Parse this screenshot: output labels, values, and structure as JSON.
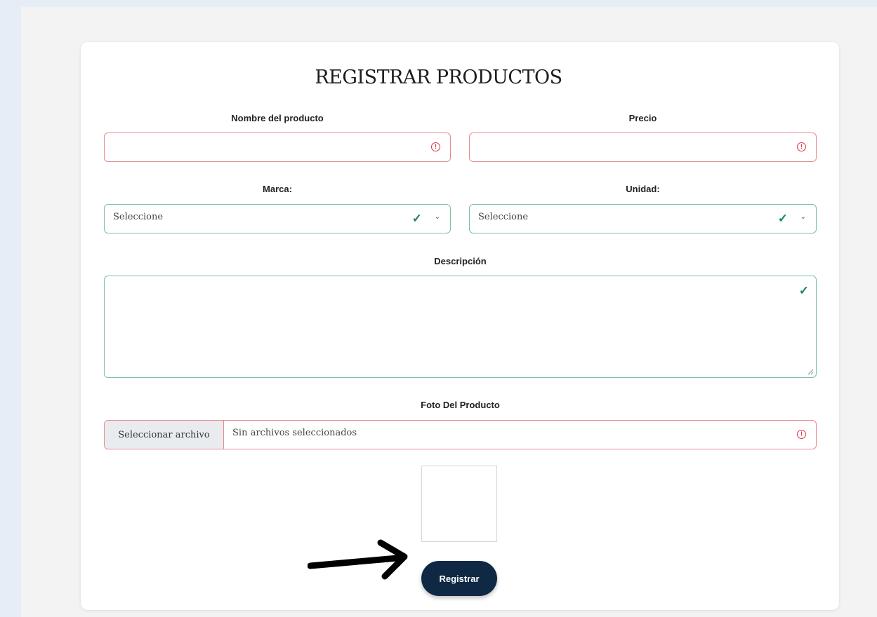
{
  "form": {
    "title": "REGISTRAR PRODUCTOS",
    "name_label": "Nombre del producto",
    "price_label": "Precio",
    "brand_label": "Marca:",
    "brand_value": "Seleccione",
    "unit_label": "Unidad:",
    "unit_value": "Seleccione",
    "description_label": "Descripción",
    "photo_label": "Foto Del Producto",
    "file_button": "Seleccionar archivo",
    "file_status": "Sin archivos seleccionados",
    "submit_label": "Registrar"
  },
  "icons": {
    "error": "!",
    "check": "✓",
    "chevron": "⌄"
  },
  "colors": {
    "invalid_border": "#e88a92",
    "valid_border": "#7cc29b",
    "submit_bg": "#0f2944"
  }
}
